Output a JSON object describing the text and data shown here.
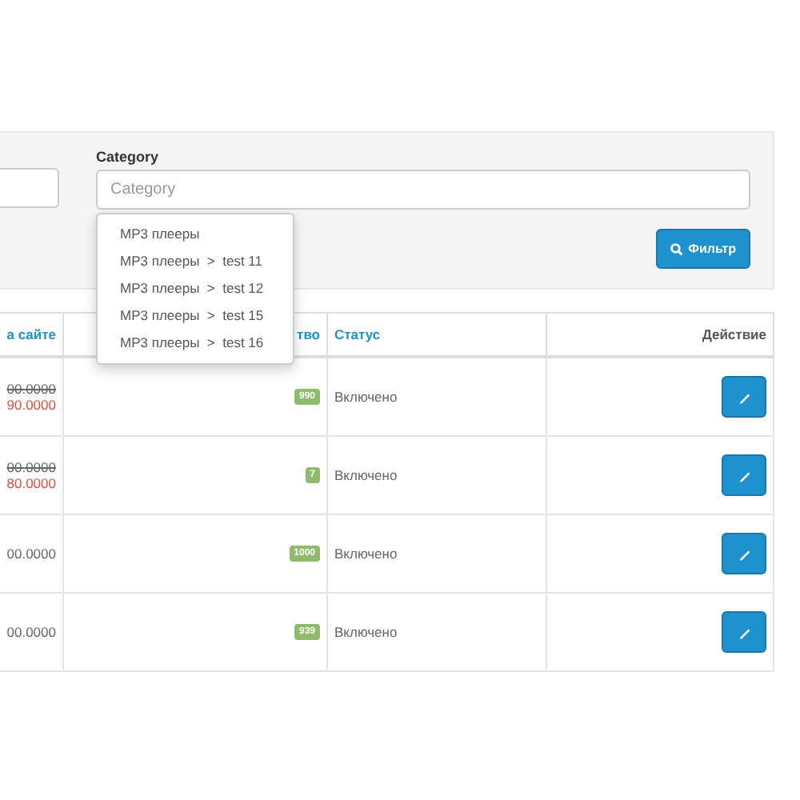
{
  "filter": {
    "category_label": "Category",
    "category_placeholder": "Category",
    "button": "Фильтр",
    "suggestions": [
      "MP3 плееры",
      "MP3 плееры  >  test 11",
      "MP3 плееры  >  test 12",
      "MP3 плееры  >  test 15",
      "MP3 плееры  >  test 16"
    ]
  },
  "table": {
    "columns": [
      "а сайте",
      "тво",
      "Статус",
      "Действие"
    ],
    "rows": [
      {
        "price": "00.0000",
        "special": "90.0000",
        "quantity": "990",
        "status": "Включено"
      },
      {
        "price": "00.0000",
        "special": "80.0000",
        "quantity": "7",
        "status": "Включено"
      },
      {
        "price": "00.0000",
        "quantity": "1000",
        "status": "Включено"
      },
      {
        "price": "00.0000",
        "quantity": "939",
        "status": "Включено"
      }
    ]
  }
}
